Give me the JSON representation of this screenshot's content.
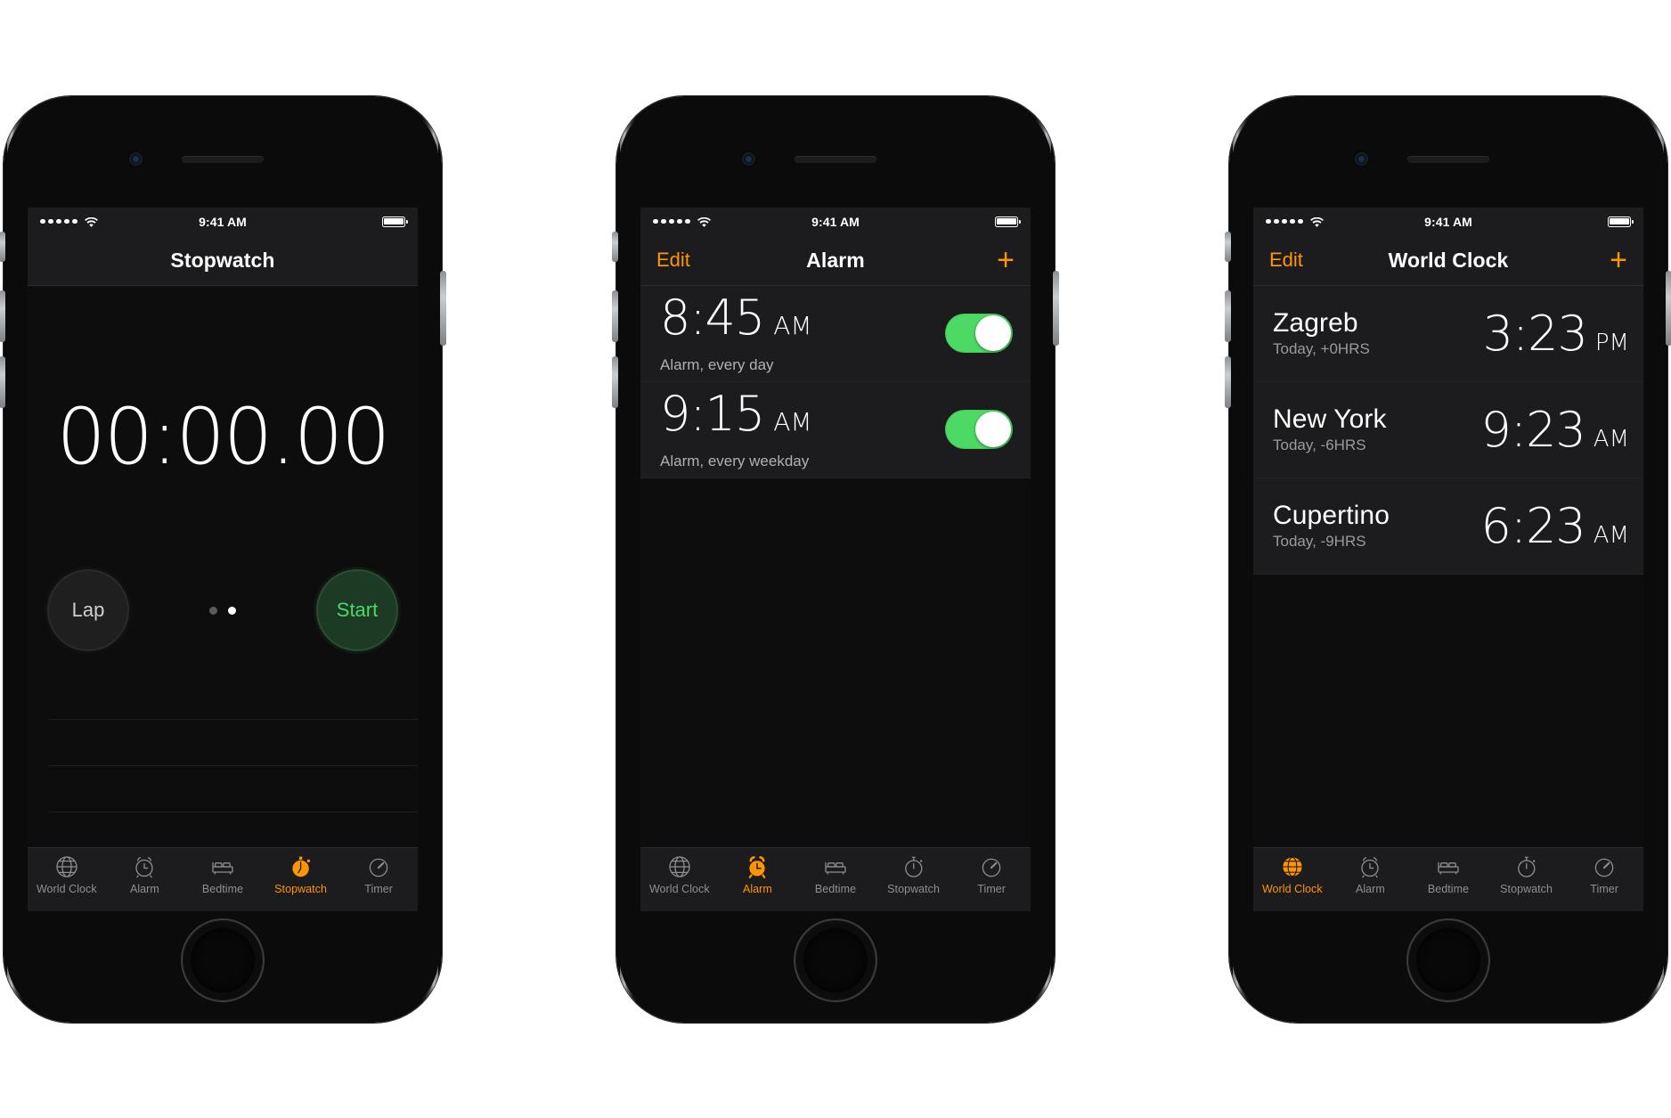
{
  "status_bar": {
    "signal_dots": 5,
    "wifi_icon": "wifi-icon",
    "time": "9:41 AM",
    "battery_icon": "battery-full-icon"
  },
  "colors": {
    "accent_orange": "#ff9500",
    "toggle_green": "#4cd964",
    "start_green_text": "#4cd964",
    "start_green_fill": "#1d3a25",
    "screen_bg": "#0d0d0d",
    "bar_bg": "#1c1c1e",
    "inactive_tab": "#8e8e93"
  },
  "tabs": [
    {
      "label": "World Clock",
      "icon": "globe-icon"
    },
    {
      "label": "Alarm",
      "icon": "alarm-clock-icon"
    },
    {
      "label": "Bedtime",
      "icon": "bed-icon"
    },
    {
      "label": "Stopwatch",
      "icon": "stopwatch-icon"
    },
    {
      "label": "Timer",
      "icon": "timer-icon"
    }
  ],
  "phones": [
    {
      "screen": "stopwatch",
      "nav": {
        "title": "Stopwatch",
        "left_label": "",
        "right_icon": ""
      },
      "active_tab": "Stopwatch",
      "stopwatch": {
        "display": "00:00.00",
        "lap_label": "Lap",
        "start_label": "Start",
        "page_dots": 2,
        "active_dot": 2,
        "lap_rows": 4
      }
    },
    {
      "screen": "alarm",
      "nav": {
        "title": "Alarm",
        "left_label": "Edit",
        "right_icon": "plus-icon"
      },
      "active_tab": "Alarm",
      "alarms": [
        {
          "time": "8:45",
          "ampm": "AM",
          "subtitle": "Alarm, every day",
          "enabled": true
        },
        {
          "time": "9:15",
          "ampm": "AM",
          "subtitle": "Alarm, every weekday",
          "enabled": true
        }
      ]
    },
    {
      "screen": "world_clock",
      "nav": {
        "title": "World Clock",
        "left_label": "Edit",
        "right_icon": "plus-icon"
      },
      "active_tab": "World Clock",
      "cities": [
        {
          "city": "Zagreb",
          "subtitle": "Today, +0HRS",
          "time": "3:23",
          "ampm": "PM"
        },
        {
          "city": "New York",
          "subtitle": "Today, -6HRS",
          "time": "9:23",
          "ampm": "AM"
        },
        {
          "city": "Cupertino",
          "subtitle": "Today, -9HRS",
          "time": "6:23",
          "ampm": "AM"
        }
      ]
    }
  ]
}
